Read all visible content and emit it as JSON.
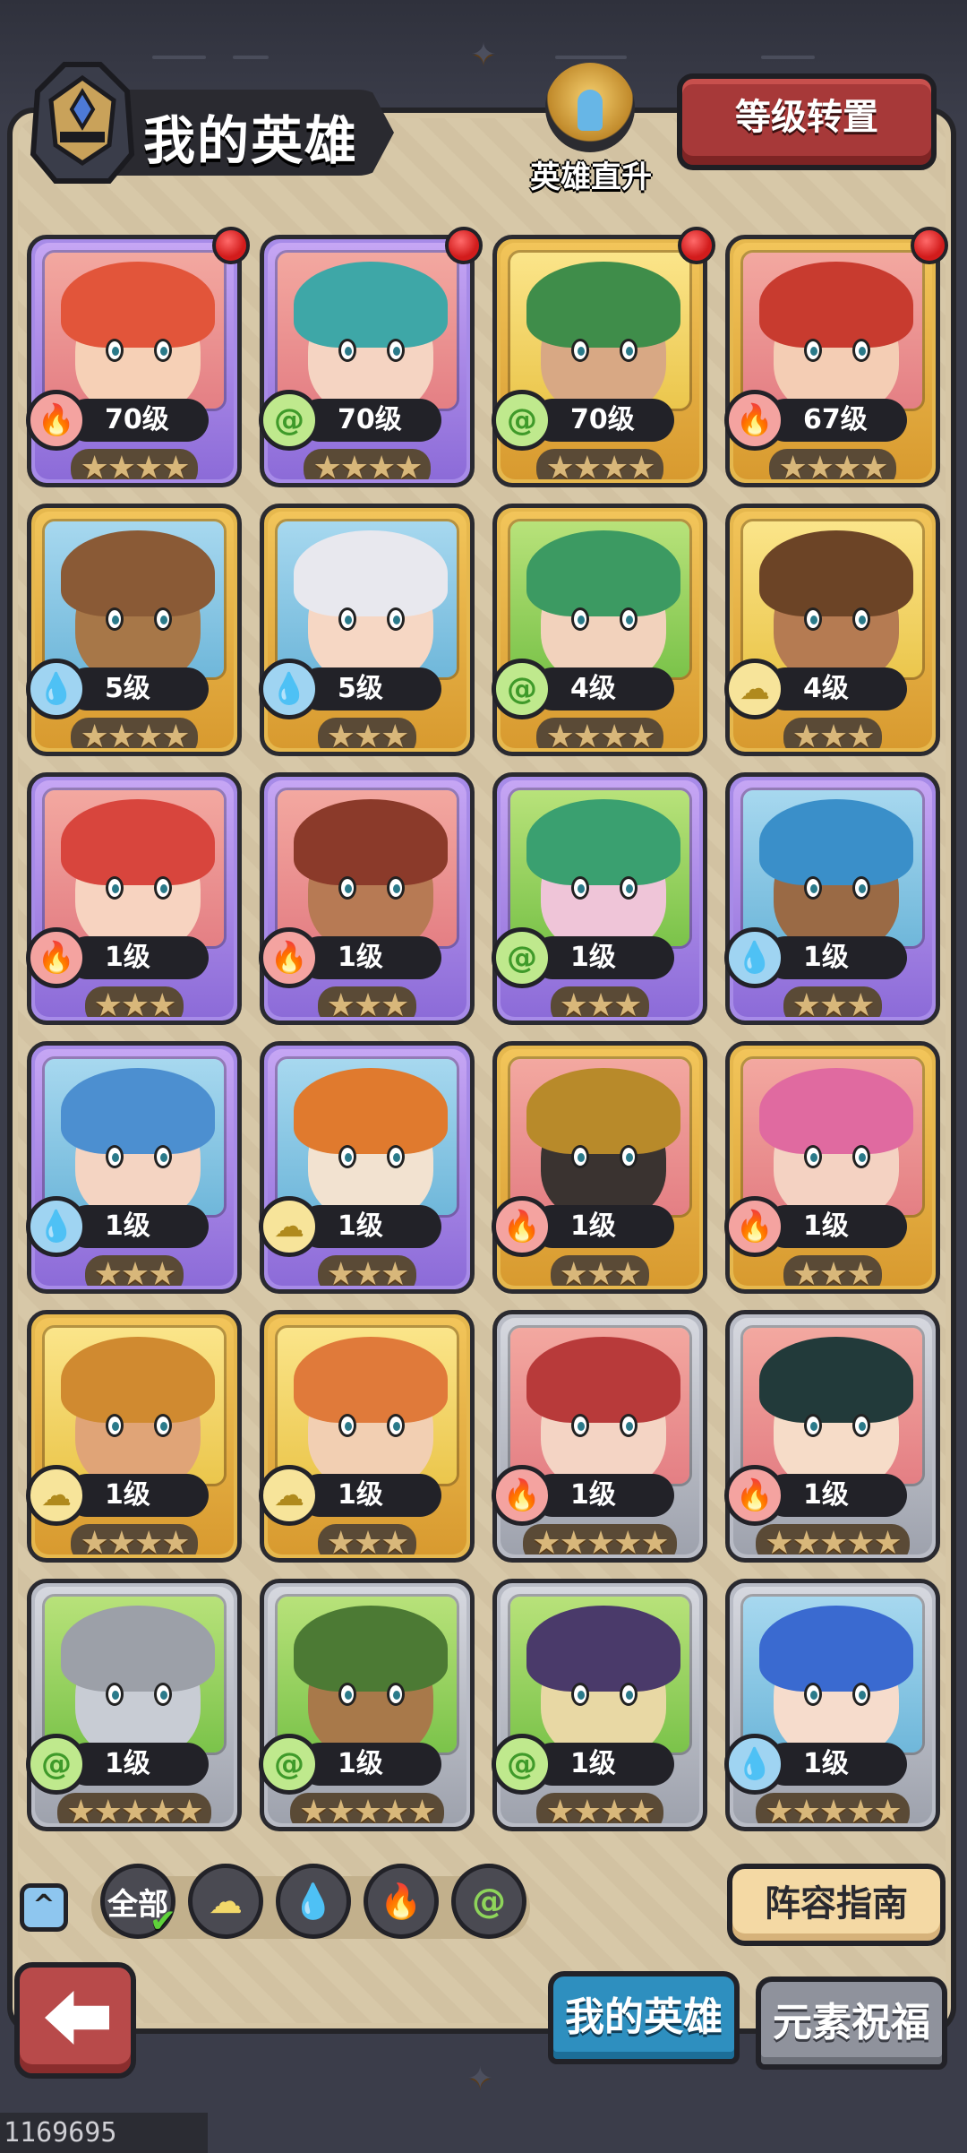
{
  "header": {
    "title": "我的英雄",
    "rise_label": "英雄直升",
    "level_transfer_label": "等级转置"
  },
  "heroes": [
    {
      "level": "70级",
      "element": "fire",
      "stars": 4,
      "frame": "purple",
      "bg": "pink",
      "hair": "#e2553a",
      "skin": "#f6d0b6",
      "dot": true
    },
    {
      "level": "70级",
      "element": "wind",
      "stars": 4,
      "frame": "purple",
      "bg": "pink",
      "hair": "#3ea7a7",
      "skin": "#f5d4c2",
      "dot": true
    },
    {
      "level": "70级",
      "element": "wind",
      "stars": 4,
      "frame": "gold",
      "bg": "yellow",
      "hair": "#3f8d4a",
      "skin": "#d8a884",
      "dot": true
    },
    {
      "level": "67级",
      "element": "fire",
      "stars": 4,
      "frame": "gold",
      "bg": "pink",
      "hair": "#c83b2f",
      "skin": "#f4cdb4",
      "dot": true
    },
    {
      "level": "5级",
      "element": "water",
      "stars": 4,
      "frame": "gold",
      "bg": "blue",
      "hair": "#8a5a36",
      "skin": "#a77748",
      "dot": false
    },
    {
      "level": "5级",
      "element": "water",
      "stars": 3,
      "frame": "gold",
      "bg": "blue",
      "hair": "#e8e8ee",
      "skin": "#f6d7c4",
      "dot": false
    },
    {
      "level": "4级",
      "element": "wind",
      "stars": 4,
      "frame": "gold",
      "bg": "green",
      "hair": "#3c9a62",
      "skin": "#f2d2bc",
      "dot": false
    },
    {
      "level": "4级",
      "element": "earth",
      "stars": 3,
      "frame": "gold",
      "bg": "yellow",
      "hair": "#6c4426",
      "skin": "#b57b52",
      "dot": false
    },
    {
      "level": "1级",
      "element": "fire",
      "stars": 3,
      "frame": "purple",
      "bg": "pink",
      "hair": "#d8453d",
      "skin": "#f7d3c0",
      "dot": false
    },
    {
      "level": "1级",
      "element": "fire",
      "stars": 3,
      "frame": "purple",
      "bg": "pink",
      "hair": "#8b3a2a",
      "skin": "#b77a54",
      "dot": false
    },
    {
      "level": "1级",
      "element": "wind",
      "stars": 3,
      "frame": "purple",
      "bg": "green",
      "hair": "#3aa070",
      "skin": "#efc5d8",
      "dot": false
    },
    {
      "level": "1级",
      "element": "water",
      "stars": 3,
      "frame": "purple",
      "bg": "blue",
      "hair": "#3a8fc9",
      "skin": "#9a6a45",
      "dot": false
    },
    {
      "level": "1级",
      "element": "water",
      "stars": 3,
      "frame": "purple",
      "bg": "blue",
      "hair": "#4c8fd0",
      "skin": "#f4d4c2",
      "dot": false
    },
    {
      "level": "1级",
      "element": "earth",
      "stars": 3,
      "frame": "purple",
      "bg": "blue",
      "hair": "#e07a2e",
      "skin": "#f2e2d0",
      "dot": false
    },
    {
      "level": "1级",
      "element": "fire",
      "stars": 3,
      "frame": "gold",
      "bg": "pink",
      "hair": "#b88a2a",
      "skin": "#3a3330",
      "dot": false
    },
    {
      "level": "1级",
      "element": "fire",
      "stars": 3,
      "frame": "gold",
      "bg": "pink",
      "hair": "#e06aa0",
      "skin": "#f4d2c2",
      "dot": false
    },
    {
      "level": "1级",
      "element": "earth",
      "stars": 4,
      "frame": "gold",
      "bg": "yellow",
      "hair": "#d08a30",
      "skin": "#e0a477",
      "dot": false
    },
    {
      "level": "1级",
      "element": "earth",
      "stars": 3,
      "frame": "gold",
      "bg": "yellow",
      "hair": "#e07a3a",
      "skin": "#f2cfb2",
      "dot": false
    },
    {
      "level": "1级",
      "element": "fire",
      "stars": 5,
      "frame": "silver",
      "bg": "pink",
      "hair": "#b83a3a",
      "skin": "#f4d4c4",
      "dot": false
    },
    {
      "level": "1级",
      "element": "fire",
      "stars": 5,
      "frame": "silver",
      "bg": "pink",
      "hair": "#223a3a",
      "skin": "#f6dcc8",
      "dot": false
    },
    {
      "level": "1级",
      "element": "wind",
      "stars": 5,
      "frame": "silver",
      "bg": "green",
      "hair": "#9ca0a8",
      "skin": "#c8ccd4",
      "dot": false
    },
    {
      "level": "1级",
      "element": "wind",
      "stars": 5,
      "frame": "silver",
      "bg": "green",
      "hair": "#4c7a34",
      "skin": "#a8794a",
      "dot": false
    },
    {
      "level": "1级",
      "element": "wind",
      "stars": 4,
      "frame": "silver",
      "bg": "green",
      "hair": "#4a3a6a",
      "skin": "#e8d8a4",
      "dot": false
    },
    {
      "level": "1级",
      "element": "water",
      "stars": 5,
      "frame": "silver",
      "bg": "blue",
      "hair": "#3a6ad0",
      "skin": "#f6dccc",
      "dot": false
    }
  ],
  "filters": {
    "all_label": "全部",
    "elements": [
      "earth",
      "water",
      "fire",
      "wind"
    ]
  },
  "guide_label": "阵容指南",
  "tabs": {
    "my_heroes": "我的英雄",
    "element_blessing": "元素祝福"
  },
  "footer_id": "1169695 5d6836",
  "colors": {
    "panel": "#d6c6a5",
    "red_button": "#a73939",
    "active_tab": "#2e8fbf"
  }
}
